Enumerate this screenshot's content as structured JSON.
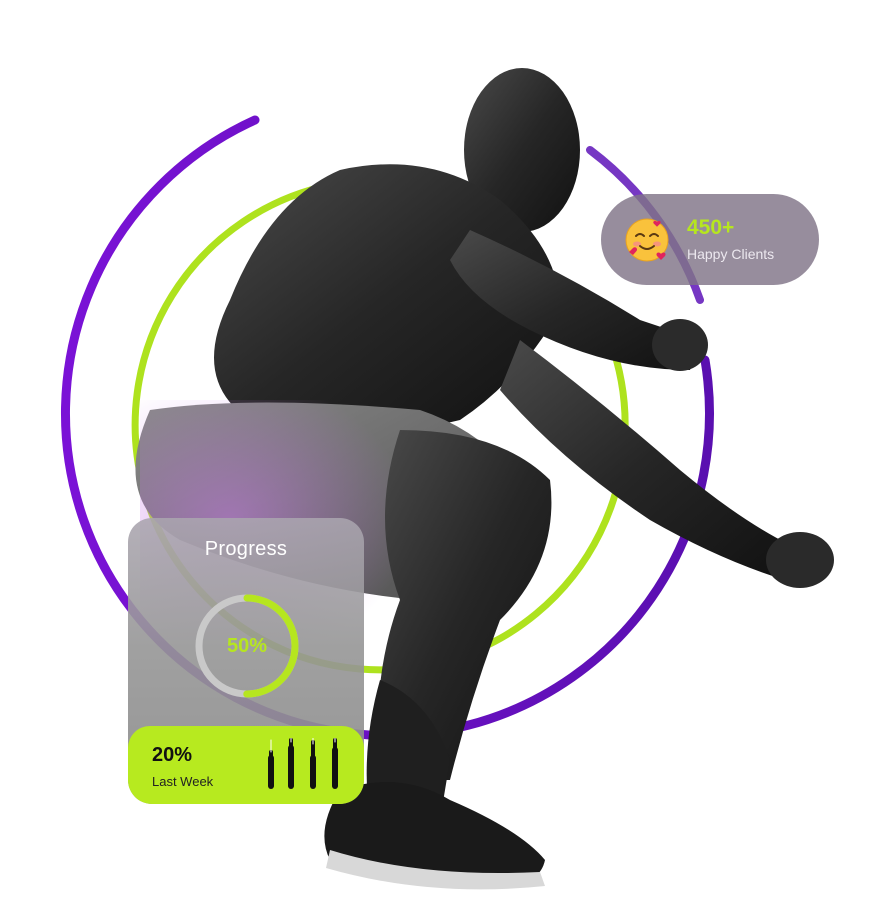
{
  "clients": {
    "count": "450+",
    "label": "Happy Clients",
    "emoji": "smiling-face-with-hearts"
  },
  "progress": {
    "title": "Progress",
    "value_label": "50%",
    "value": 0.5
  },
  "last_week": {
    "value": "20%",
    "label": "Last Week"
  },
  "colors": {
    "accent_green": "#b6e61f",
    "accent_purple": "#6f15c9",
    "card_gray": "#8f8f8f"
  }
}
